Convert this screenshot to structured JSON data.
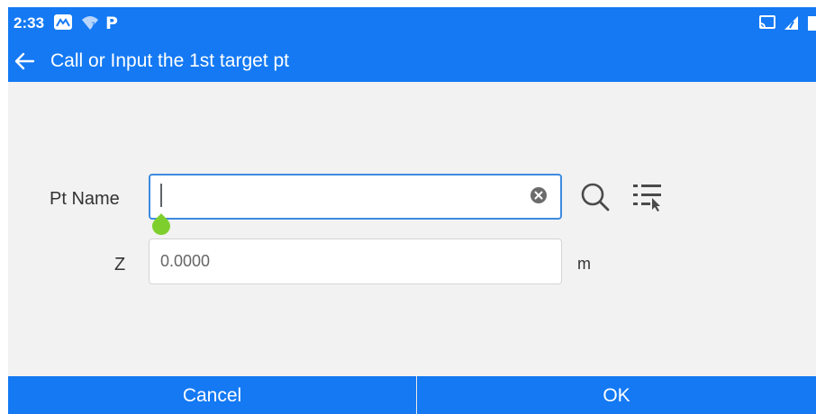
{
  "status_bar": {
    "time": "2:33",
    "left_icons": [
      "gallery-icon",
      "wifi-icon",
      "p-app-icon"
    ],
    "right_icons": [
      "cast-icon",
      "signal-icon",
      "battery-icon"
    ],
    "p_app_glyph": "P"
  },
  "app_bar": {
    "title": "Call or Input the 1st target pt",
    "back_icon": "arrow-left-icon"
  },
  "form": {
    "pt_name": {
      "label": "Pt Name",
      "value": "",
      "focused": true
    },
    "z": {
      "label": "Z",
      "placeholder": "0.0000",
      "unit": "m"
    },
    "tools": [
      "search-icon",
      "select-list-icon"
    ]
  },
  "buttons": {
    "cancel": "Cancel",
    "ok": "OK"
  },
  "colors": {
    "primary": "#1479f3",
    "background": "#f2f2f2",
    "focus_border": "#3d8be0",
    "text_handle": "#7ecf2e"
  }
}
